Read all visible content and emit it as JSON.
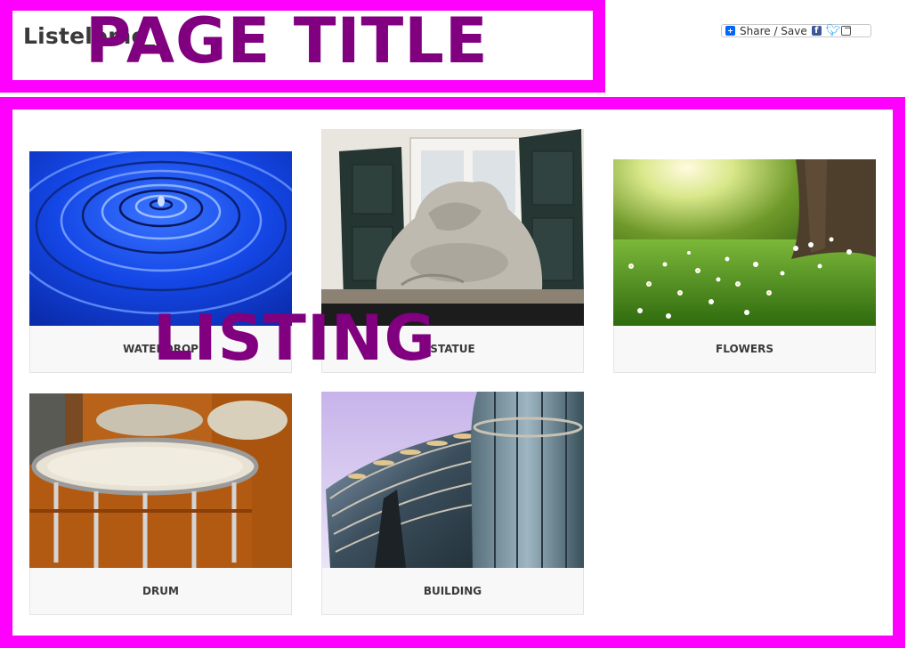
{
  "header": {
    "site_title": "Listeleme",
    "title_overlay": "PAGE TITLE",
    "share_label": "Share / Save"
  },
  "listing": {
    "overlay": "LISTING",
    "items": [
      {
        "label": "WATERDROP",
        "image": "water-ripple"
      },
      {
        "label": "STATUE",
        "image": "stone-statue"
      },
      {
        "label": "FLOWERS",
        "image": "meadow-flowers"
      },
      {
        "label": "DRUM",
        "image": "drum-kit"
      },
      {
        "label": "BUILDING",
        "image": "glass-building"
      }
    ]
  },
  "colors": {
    "frame": "#ff00ff",
    "overlay_text": "#800080",
    "caption_bg": "#f8f8f8"
  }
}
